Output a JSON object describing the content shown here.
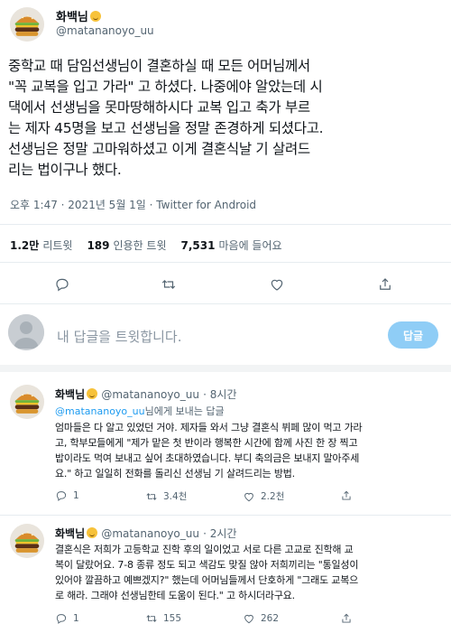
{
  "tweet": {
    "display_name": "화백님",
    "handle": "@matananoyo_uu",
    "body": "중학교 때 담임선생님이 결혼하실 때 모든 어머님께서\n\"꼭 교복을 입고 가라\" 고 하셨다. 나중에야 알았는데 시\n댁에서 선생님을 못마땅해하시다 교복 입고 축가 부르\n는 제자 45명을 보고 선생님을 정말 존경하게 되셨다고.\n선생님은 정말 고마워하셨고 이게 결혼식날 기 살려드\n리는 법이구나 했다.",
    "timestamp": "오후 1:47 · 2021년 5월 1일 · Twitter for Android",
    "stats": {
      "retweets_count": "1.2만",
      "retweets_label": "리트윗",
      "quotes_count": "189",
      "quotes_label": "인용한 트윗",
      "likes_count": "7,531",
      "likes_label": "마음에 들어요"
    },
    "icons": [
      "reply-icon",
      "retweet-icon",
      "like-icon",
      "share-icon"
    ]
  },
  "reply_box": {
    "placeholder": "내 답글을 트윗합니다.",
    "button_label": "답글"
  },
  "replies": [
    {
      "display_name": "화백님",
      "handle": "@matananoyo_uu",
      "time": "· 8시간",
      "to_handle": "@matananoyo_uu",
      "to_suffix": "님에게 보내는 답글",
      "body": "엄마들은 다 알고 있었던 거야. 제자들 와서 그냥 결혼식 뷔페 많이 먹고 가라\n고, 학부모들에게 \"제가 맡은 첫 반이라 행복한 시간에 함께 사진 한 장 찍고\n밥이라도 먹여 보내고 싶어 초대하였습니다. 부디 축의금은 보내지 말아주세\n요.\" 하고 일일히 전화를 돌리신 선생님 기 살려드리는 방법.",
      "reply_count": "1",
      "retweet_count": "3.4천",
      "like_count": "2.2천"
    },
    {
      "display_name": "화백님",
      "handle": "@matananoyo_uu",
      "time": "· 2시간",
      "to_handle": "",
      "to_suffix": "",
      "body": "결혼식은 저희가 고등학교 진학 후의 일이었고 서로 다른 고교로 진학해 교\n복이 달랐어요. 7-8 종류 정도 되고 색감도 맞질 않아 저희끼리는 \"통일성이\n있어야 깔끔하고 예쁘겠지?\" 했는데 어머님들께서 단호하게 \"그래도 교복으\n로 해라. 그래야 선생님한테 도움이 된다.\" 고 하시더라구요.",
      "reply_count": "1",
      "retweet_count": "155",
      "like_count": "262"
    }
  ],
  "colors": {
    "accent": "#1d9bf0",
    "reply_button_disabled": "#8fcdf6",
    "secondary_text": "#536471",
    "divider": "#e6ecf0"
  }
}
